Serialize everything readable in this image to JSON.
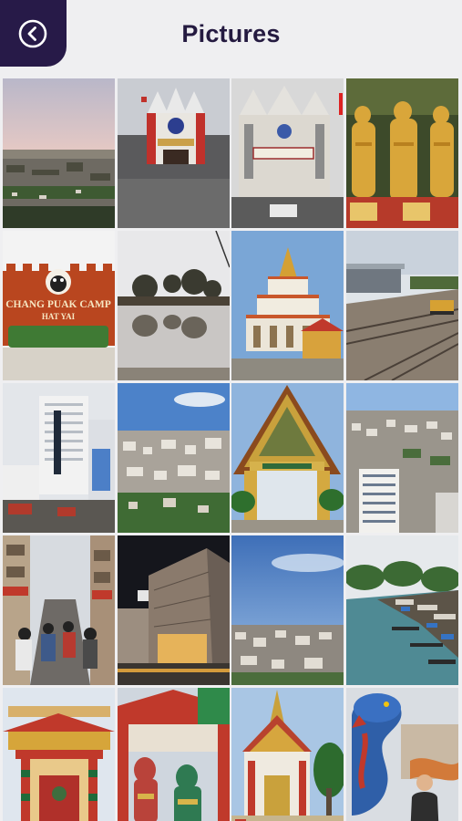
{
  "header": {
    "title": "Pictures",
    "back_icon": "chevron-left-circle-icon",
    "accent_color": "#271a48"
  },
  "gallery": {
    "photos": [
      {
        "name": "photo-city-skyline-dusk"
      },
      {
        "name": "photo-station-clock-tower"
      },
      {
        "name": "photo-hat-yai-building-facade"
      },
      {
        "name": "photo-golden-monk-statues"
      },
      {
        "name": "photo-chang-puak-camp-sign",
        "sign_text": [
          "CHANG PUAK CAMP",
          "HAT YAI"
        ]
      },
      {
        "name": "photo-pond-reflection"
      },
      {
        "name": "photo-white-pagoda-temple"
      },
      {
        "name": "photo-railway-tracks"
      },
      {
        "name": "photo-white-hotel-tower"
      },
      {
        "name": "photo-aerial-city-view"
      },
      {
        "name": "photo-golden-temple-gate"
      },
      {
        "name": "photo-city-panorama"
      },
      {
        "name": "photo-busy-market-street"
      },
      {
        "name": "photo-modern-building-night"
      },
      {
        "name": "photo-cityscape-blue-sky"
      },
      {
        "name": "photo-floating-market-canal"
      },
      {
        "name": "photo-red-chinese-shrine"
      },
      {
        "name": "photo-temple-guardian-statues"
      },
      {
        "name": "photo-ornate-thai-temple"
      },
      {
        "name": "photo-dragon-statue-visitor"
      }
    ]
  }
}
